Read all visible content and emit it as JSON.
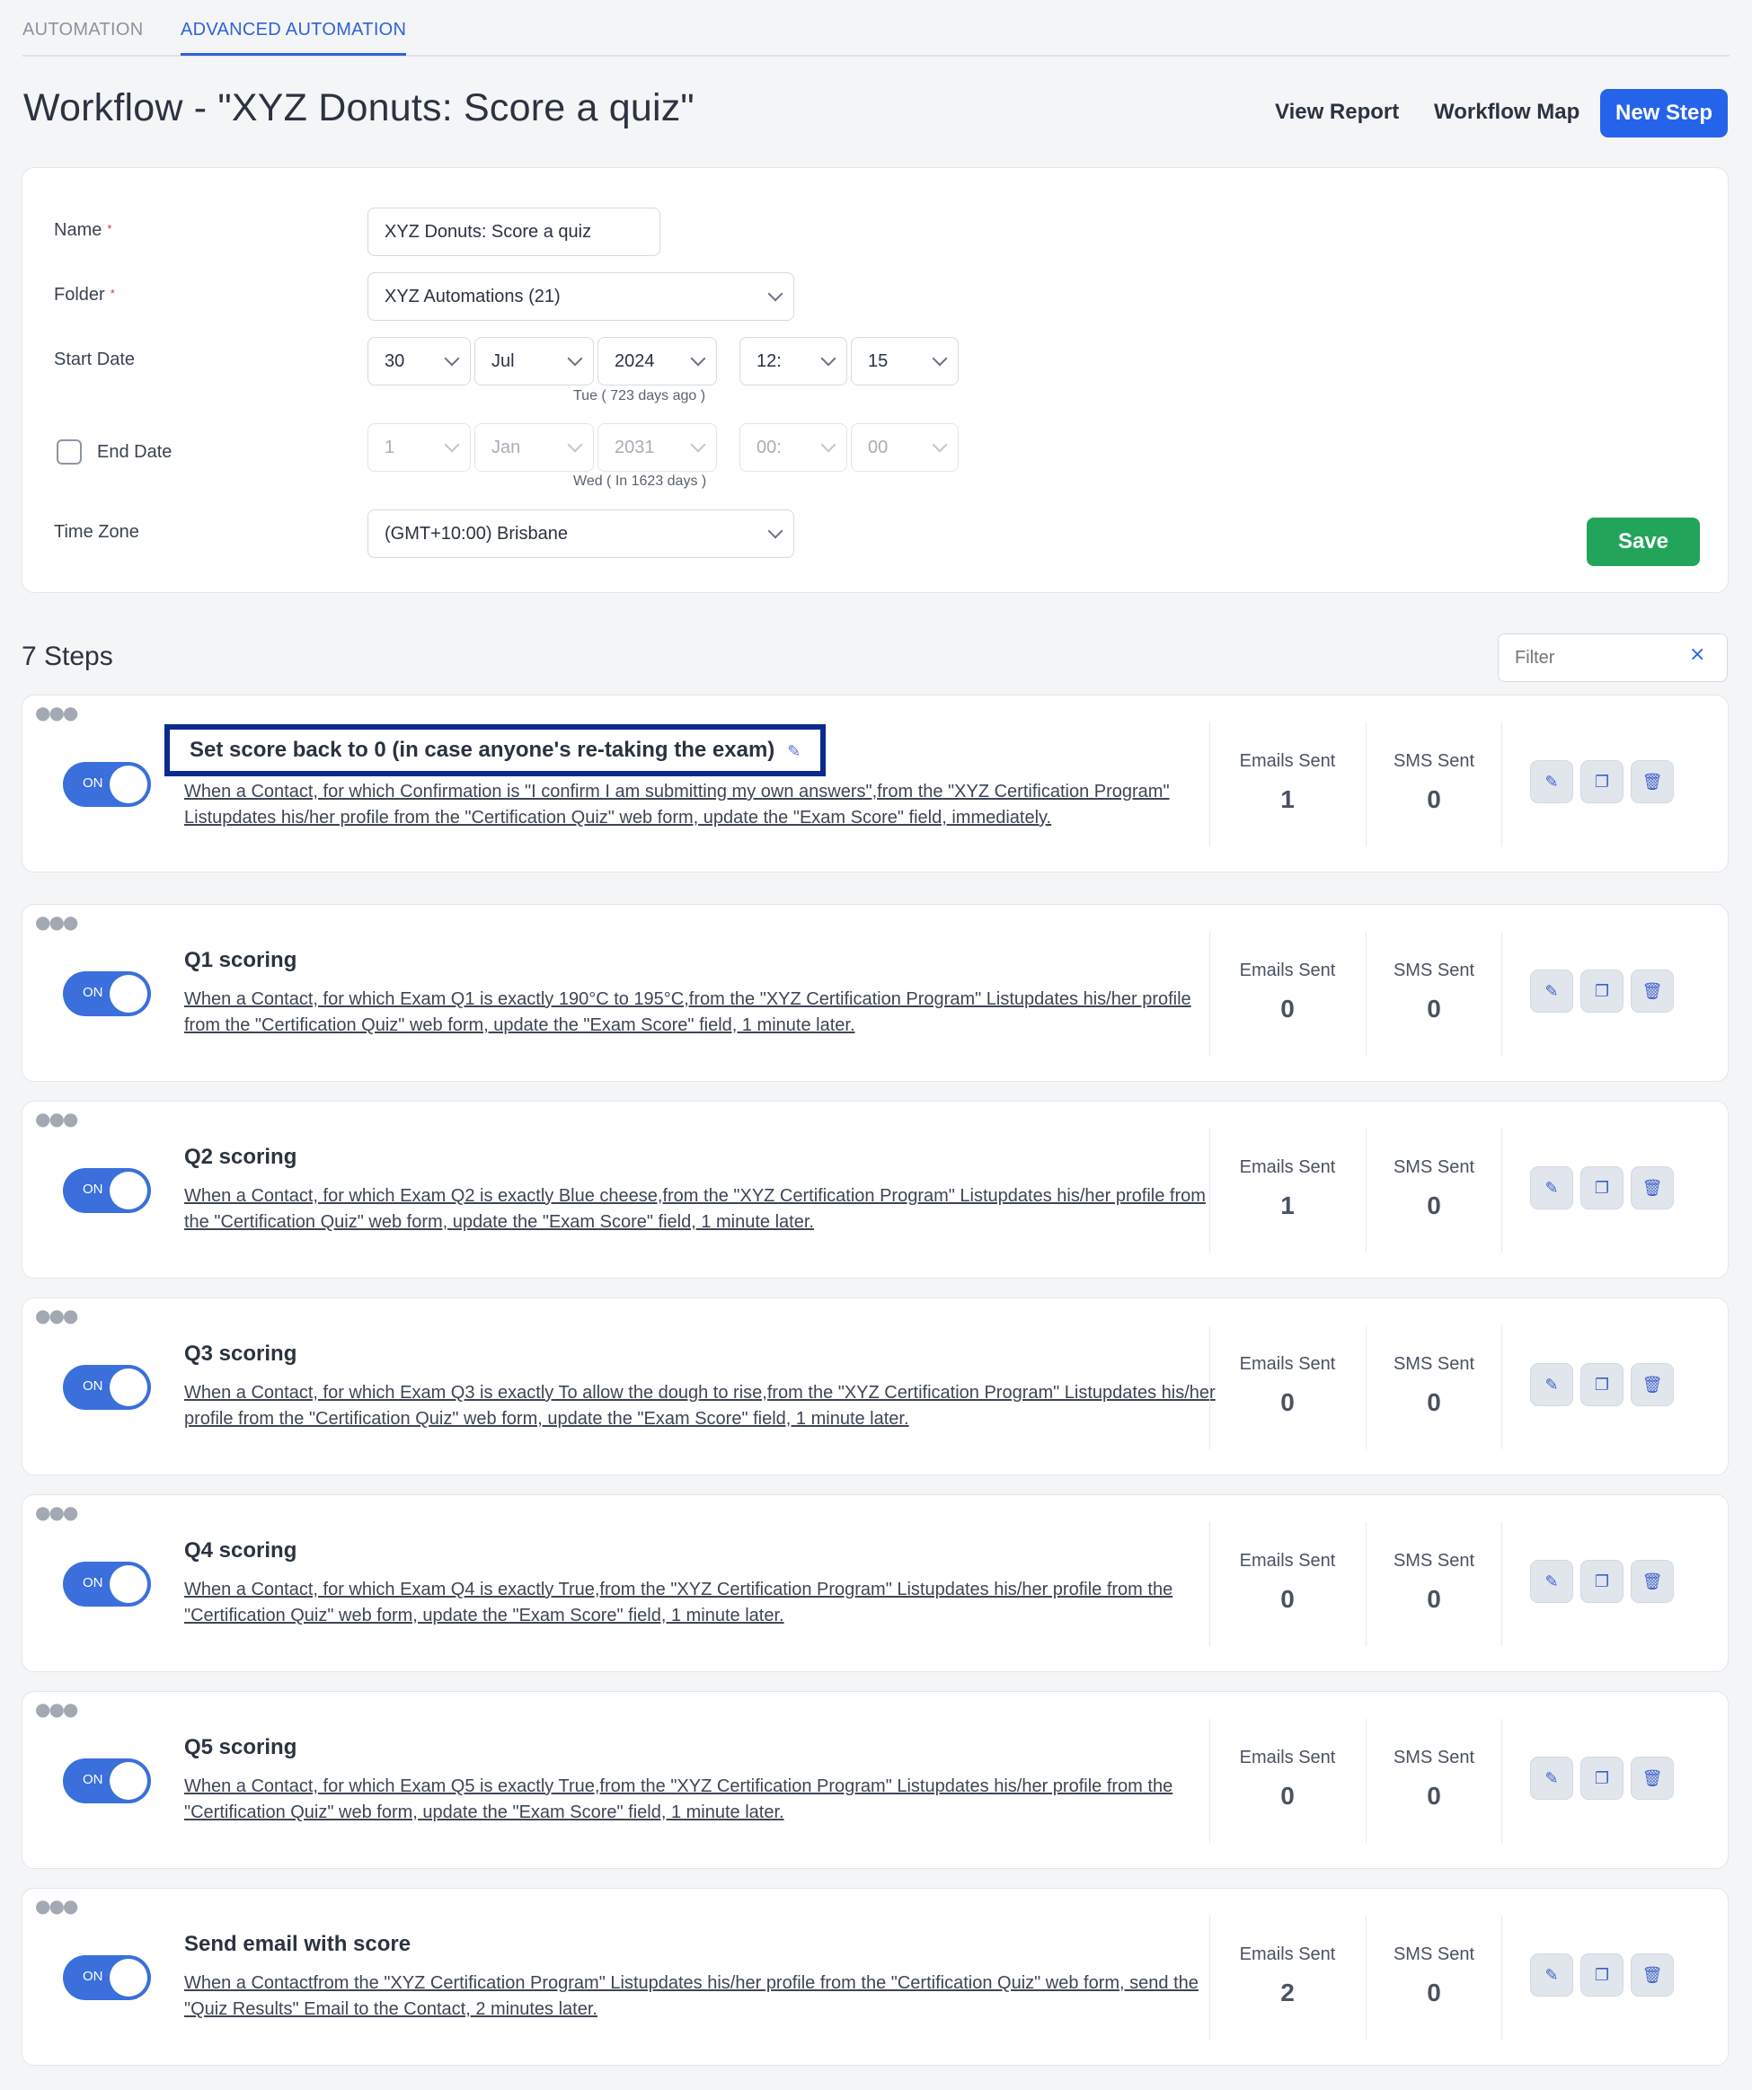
{
  "tabs": [
    {
      "label": "AUTOMATION"
    },
    {
      "label": "ADVANCED AUTOMATION"
    }
  ],
  "header": {
    "title": "Workflow - \"XYZ Donuts: Score a quiz\"",
    "view_report": "View Report",
    "workflow_map": "Workflow Map",
    "new_step": "New Step"
  },
  "settings": {
    "name_label": "Name",
    "name_value": "XYZ Donuts: Score a quiz",
    "folder_label": "Folder",
    "folder_value": "XYZ Automations (21)",
    "start_label": "Start Date",
    "start": {
      "day": "30",
      "month": "Jul",
      "year": "2024",
      "hour": "12:",
      "minute": "15"
    },
    "start_hint": "Tue ( 723 days ago )",
    "end_label": "End Date",
    "end": {
      "day": "1",
      "month": "Jan",
      "year": "2031",
      "hour": "00:",
      "minute": "00"
    },
    "end_hint": "Wed ( In 1623 days )",
    "tz_label": "Time Zone",
    "tz_value": "(GMT+10:00) Brisbane",
    "save": "Save",
    "required_mark": "*"
  },
  "steps_section": {
    "title": "7 Steps",
    "filter_placeholder": "Filter",
    "filter_clear": "×"
  },
  "labels": {
    "on": "ON",
    "emails_sent": "Emails Sent",
    "sms_sent": "SMS Sent"
  },
  "steps": [
    {
      "title": "Set score back to 0 (in case anyone's re-taking the exam)",
      "desc": "When a Contact, for which Confirmation is \"I confirm I am submitting my own answers\",from the \"XYZ Certification Program\" Listupdates his/her profile from the \"Certification Quiz\" web form, update the \"Exam Score\" field, immediately.",
      "emails": "1",
      "sms": "0"
    },
    {
      "title": "Q1 scoring",
      "desc": "When a Contact, for which Exam Q1 is exactly 190°C to 195°C,from the \"XYZ Certification Program\" Listupdates his/her profile from the \"Certification Quiz\" web form, update the \"Exam Score\" field, 1 minute later.",
      "emails": "0",
      "sms": "0"
    },
    {
      "title": "Q2 scoring",
      "desc": "When a Contact, for which Exam Q2 is exactly Blue cheese,from the \"XYZ Certification Program\" Listupdates his/her profile from the \"Certification Quiz\" web form, update the \"Exam Score\" field, 1 minute later.",
      "emails": "1",
      "sms": "0"
    },
    {
      "title": "Q3 scoring",
      "desc": "When a Contact, for which Exam Q3 is exactly To allow the dough to rise,from the \"XYZ Certification Program\" Listupdates his/her profile from the \"Certification Quiz\" web form, update the \"Exam Score\" field, 1 minute later.",
      "emails": "0",
      "sms": "0"
    },
    {
      "title": "Q4 scoring",
      "desc": "When a Contact, for which Exam Q4 is exactly True,from the \"XYZ Certification Program\" Listupdates his/her profile from the \"Certification Quiz\" web form, update the \"Exam Score\" field, 1 minute later.",
      "emails": "0",
      "sms": "0"
    },
    {
      "title": "Q5 scoring",
      "desc": "When a Contact, for which Exam Q5 is exactly True,from the \"XYZ Certification Program\" Listupdates his/her profile from the \"Certification Quiz\" web form, update the \"Exam Score\" field, 1 minute later.",
      "emails": "0",
      "sms": "0"
    },
    {
      "title": "Send email with score",
      "desc": "When a Contactfrom the \"XYZ Certification Program\" Listupdates his/her profile from the \"Certification Quiz\" web form, send the \"Quiz Results\" Email to the Contact, 2 minutes later.",
      "emails": "2",
      "sms": "0"
    }
  ],
  "icons": {
    "edit": "pencil-icon",
    "copy": "copy-icon",
    "delete": "trash-icon",
    "drag": "drag-handle-icon"
  },
  "colors": {
    "accent": "#2563eb",
    "save": "#22a55b",
    "toggle_on": "#3a6fdc",
    "highlight_border": "#0b2a8f"
  }
}
